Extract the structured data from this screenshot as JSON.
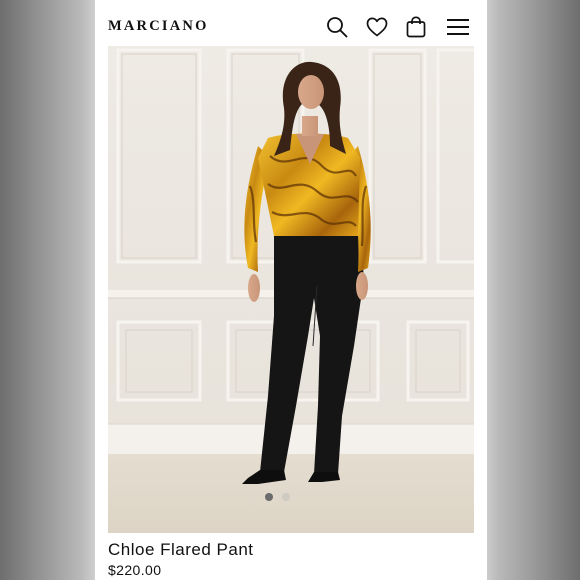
{
  "header": {
    "brand": "MARCIANO",
    "icons": [
      "search-icon",
      "heart-icon",
      "bag-icon",
      "menu-icon"
    ]
  },
  "product": {
    "title": "Chloe Flared Pant",
    "price": "$220.00"
  },
  "carousel": {
    "slide_count": 2,
    "active_index": 0
  },
  "colors": {
    "text": "#111111",
    "background": "#ffffff",
    "wall": "#ece8e1",
    "pants": "#151515",
    "blouse_gold": "#d9a41a"
  }
}
